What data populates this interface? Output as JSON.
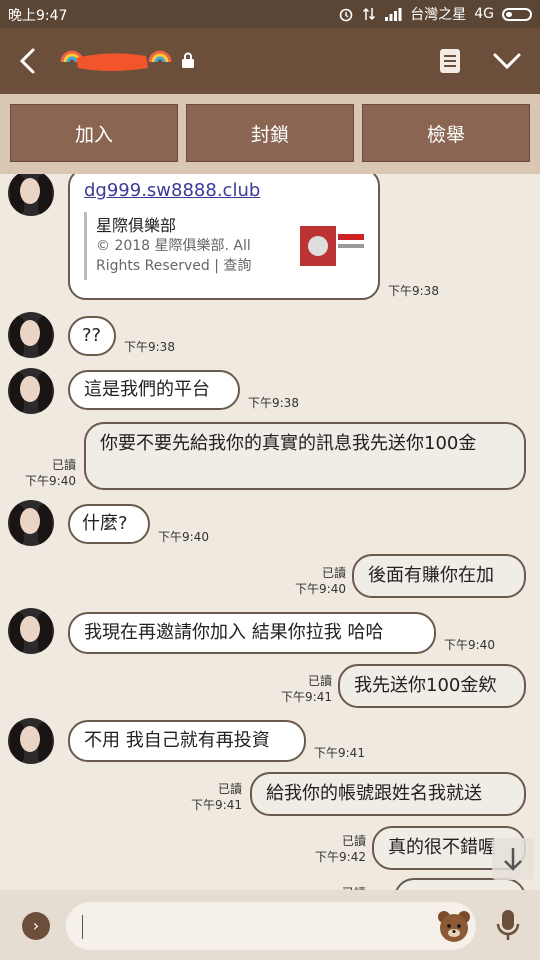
{
  "status_bar": {
    "time": "晚上9:47",
    "carrier": "台灣之星",
    "network": "4G"
  },
  "header": {
    "contact_name_redacted": true
  },
  "actions": [
    {
      "label": "加入"
    },
    {
      "label": "封鎖"
    },
    {
      "label": "檢舉"
    }
  ],
  "link_card": {
    "url": "dg999.sw8888.club",
    "title": "星際俱樂部",
    "desc": "© 2018 星際俱樂部. All Rights Reserved  | 查詢",
    "time": "下午9:38"
  },
  "messages": [
    {
      "dir": "in",
      "text": "??",
      "time": "下午9:38"
    },
    {
      "dir": "in",
      "text": "這是我們的平台",
      "time": "下午9:38"
    },
    {
      "dir": "out",
      "text": "你要不要先給我你的真實的訊息我先送你100金",
      "time": "下午9:40",
      "read": "已讀"
    },
    {
      "dir": "in",
      "text": "什麼?",
      "time": "下午9:40"
    },
    {
      "dir": "out",
      "text": "後面有賺你在加",
      "time": "下午9:40",
      "read": "已讀"
    },
    {
      "dir": "in",
      "text": "我現在再邀請你加入 結果你拉我 哈哈",
      "time": "下午9:40"
    },
    {
      "dir": "out",
      "text": "我先送你100金欸",
      "time": "下午9:41",
      "read": "已讀"
    },
    {
      "dir": "in",
      "text": "不用 我自己就有再投資",
      "time": "下午9:41"
    },
    {
      "dir": "out",
      "text": "給我你的帳號跟姓名我就送",
      "time": "下午9:41",
      "read": "已讀"
    },
    {
      "dir": "out",
      "text": "真的很不錯喔",
      "time": "下午9:42",
      "read": "已讀"
    },
    {
      "dir": "out",
      "text": "",
      "time": "",
      "read": "已讀"
    }
  ],
  "input": {
    "placeholder": ""
  },
  "colors": {
    "header": "#6b4f3a",
    "status": "#5b4636",
    "action_button": "#8a6552",
    "chat_bg": "#efe9df"
  }
}
